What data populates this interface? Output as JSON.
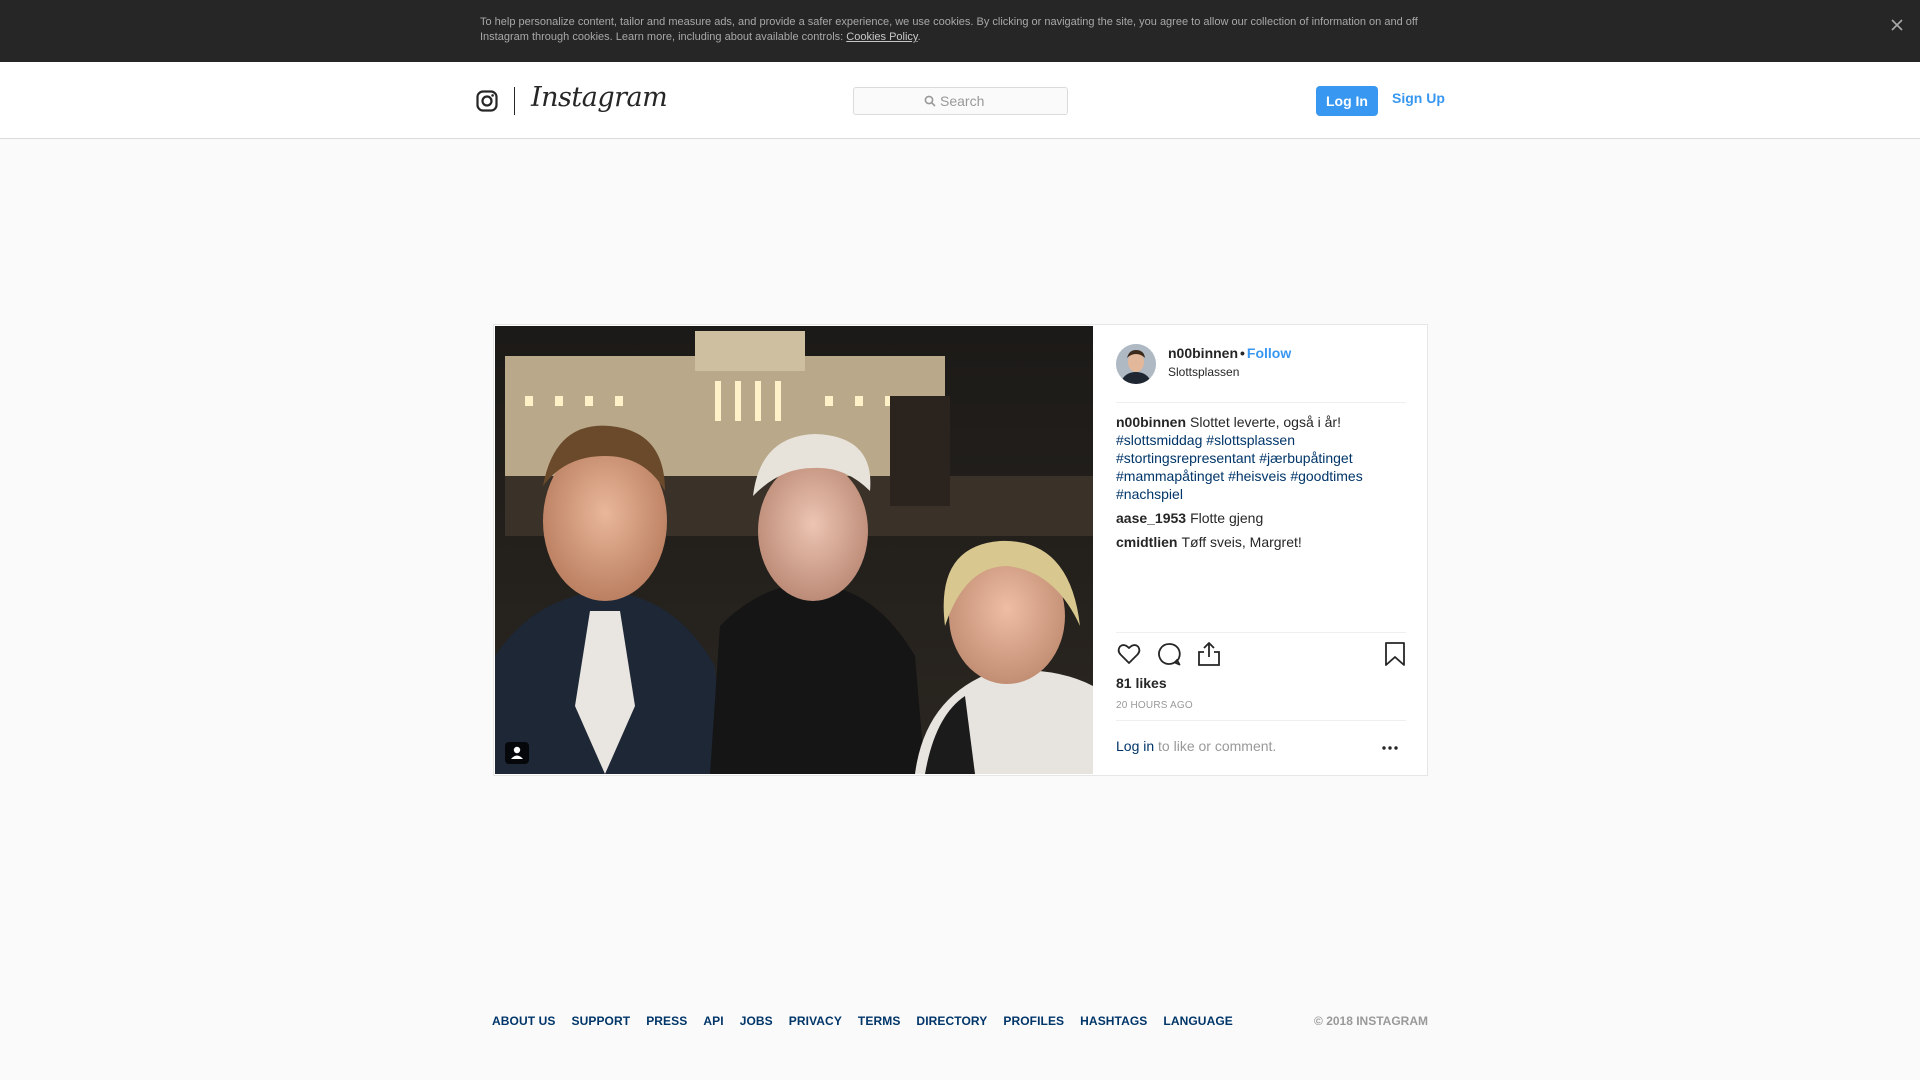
{
  "cookie_banner": {
    "text": "To help personalize content, tailor and measure ads, and provide a safer experience, we use cookies. By clicking or navigating the site, you agree to allow our collection of information on and off Instagram through cookies. Learn more, including about available controls: ",
    "link_label": "Cookies Policy",
    "suffix": "."
  },
  "header": {
    "wordmark": "Instagram",
    "search_placeholder": "Search",
    "login_label": "Log In",
    "signup_label": "Sign Up"
  },
  "post": {
    "username": "n00binnen",
    "separator": "•",
    "follow_label": "Follow",
    "location": "Slottsplassen",
    "caption_user": "n00binnen",
    "caption_text": "Slottet leverte, også i år!",
    "hashtags": [
      "#slottsmiddag",
      "#slottsplassen",
      "#stortingsrepresentant",
      "#jærbupåtinget",
      "#mammapåtinget",
      "#heisveis",
      "#goodtimes",
      "#nachspiel"
    ],
    "comments": [
      {
        "user": "aase_1953",
        "text": "Flotte gjeng"
      },
      {
        "user": "cmidtlien",
        "text": "Tøff sveis, Margret!"
      }
    ],
    "likes": "81 likes",
    "time": "20 HOURS AGO",
    "login_link": "Log in",
    "login_suffix": " to like or comment."
  },
  "footer": {
    "links": [
      "ABOUT US",
      "SUPPORT",
      "PRESS",
      "API",
      "JOBS",
      "PRIVACY",
      "TERMS",
      "DIRECTORY",
      "PROFILES",
      "HASHTAGS",
      "LANGUAGE"
    ],
    "copyright": "© 2018 INSTAGRAM"
  },
  "colors": {
    "accent": "#3897f0",
    "link_dark": "#003569",
    "banner_bg": "#262626"
  },
  "icons": {
    "cookie_close": "close-icon",
    "logo": "instagram-glyph-icon",
    "search": "search-icon",
    "photo_tag": "user-tag-icon",
    "like": "heart-icon",
    "comment": "comment-bubble-icon",
    "share": "share-icon",
    "save": "bookmark-icon",
    "more": "more-options-icon"
  }
}
